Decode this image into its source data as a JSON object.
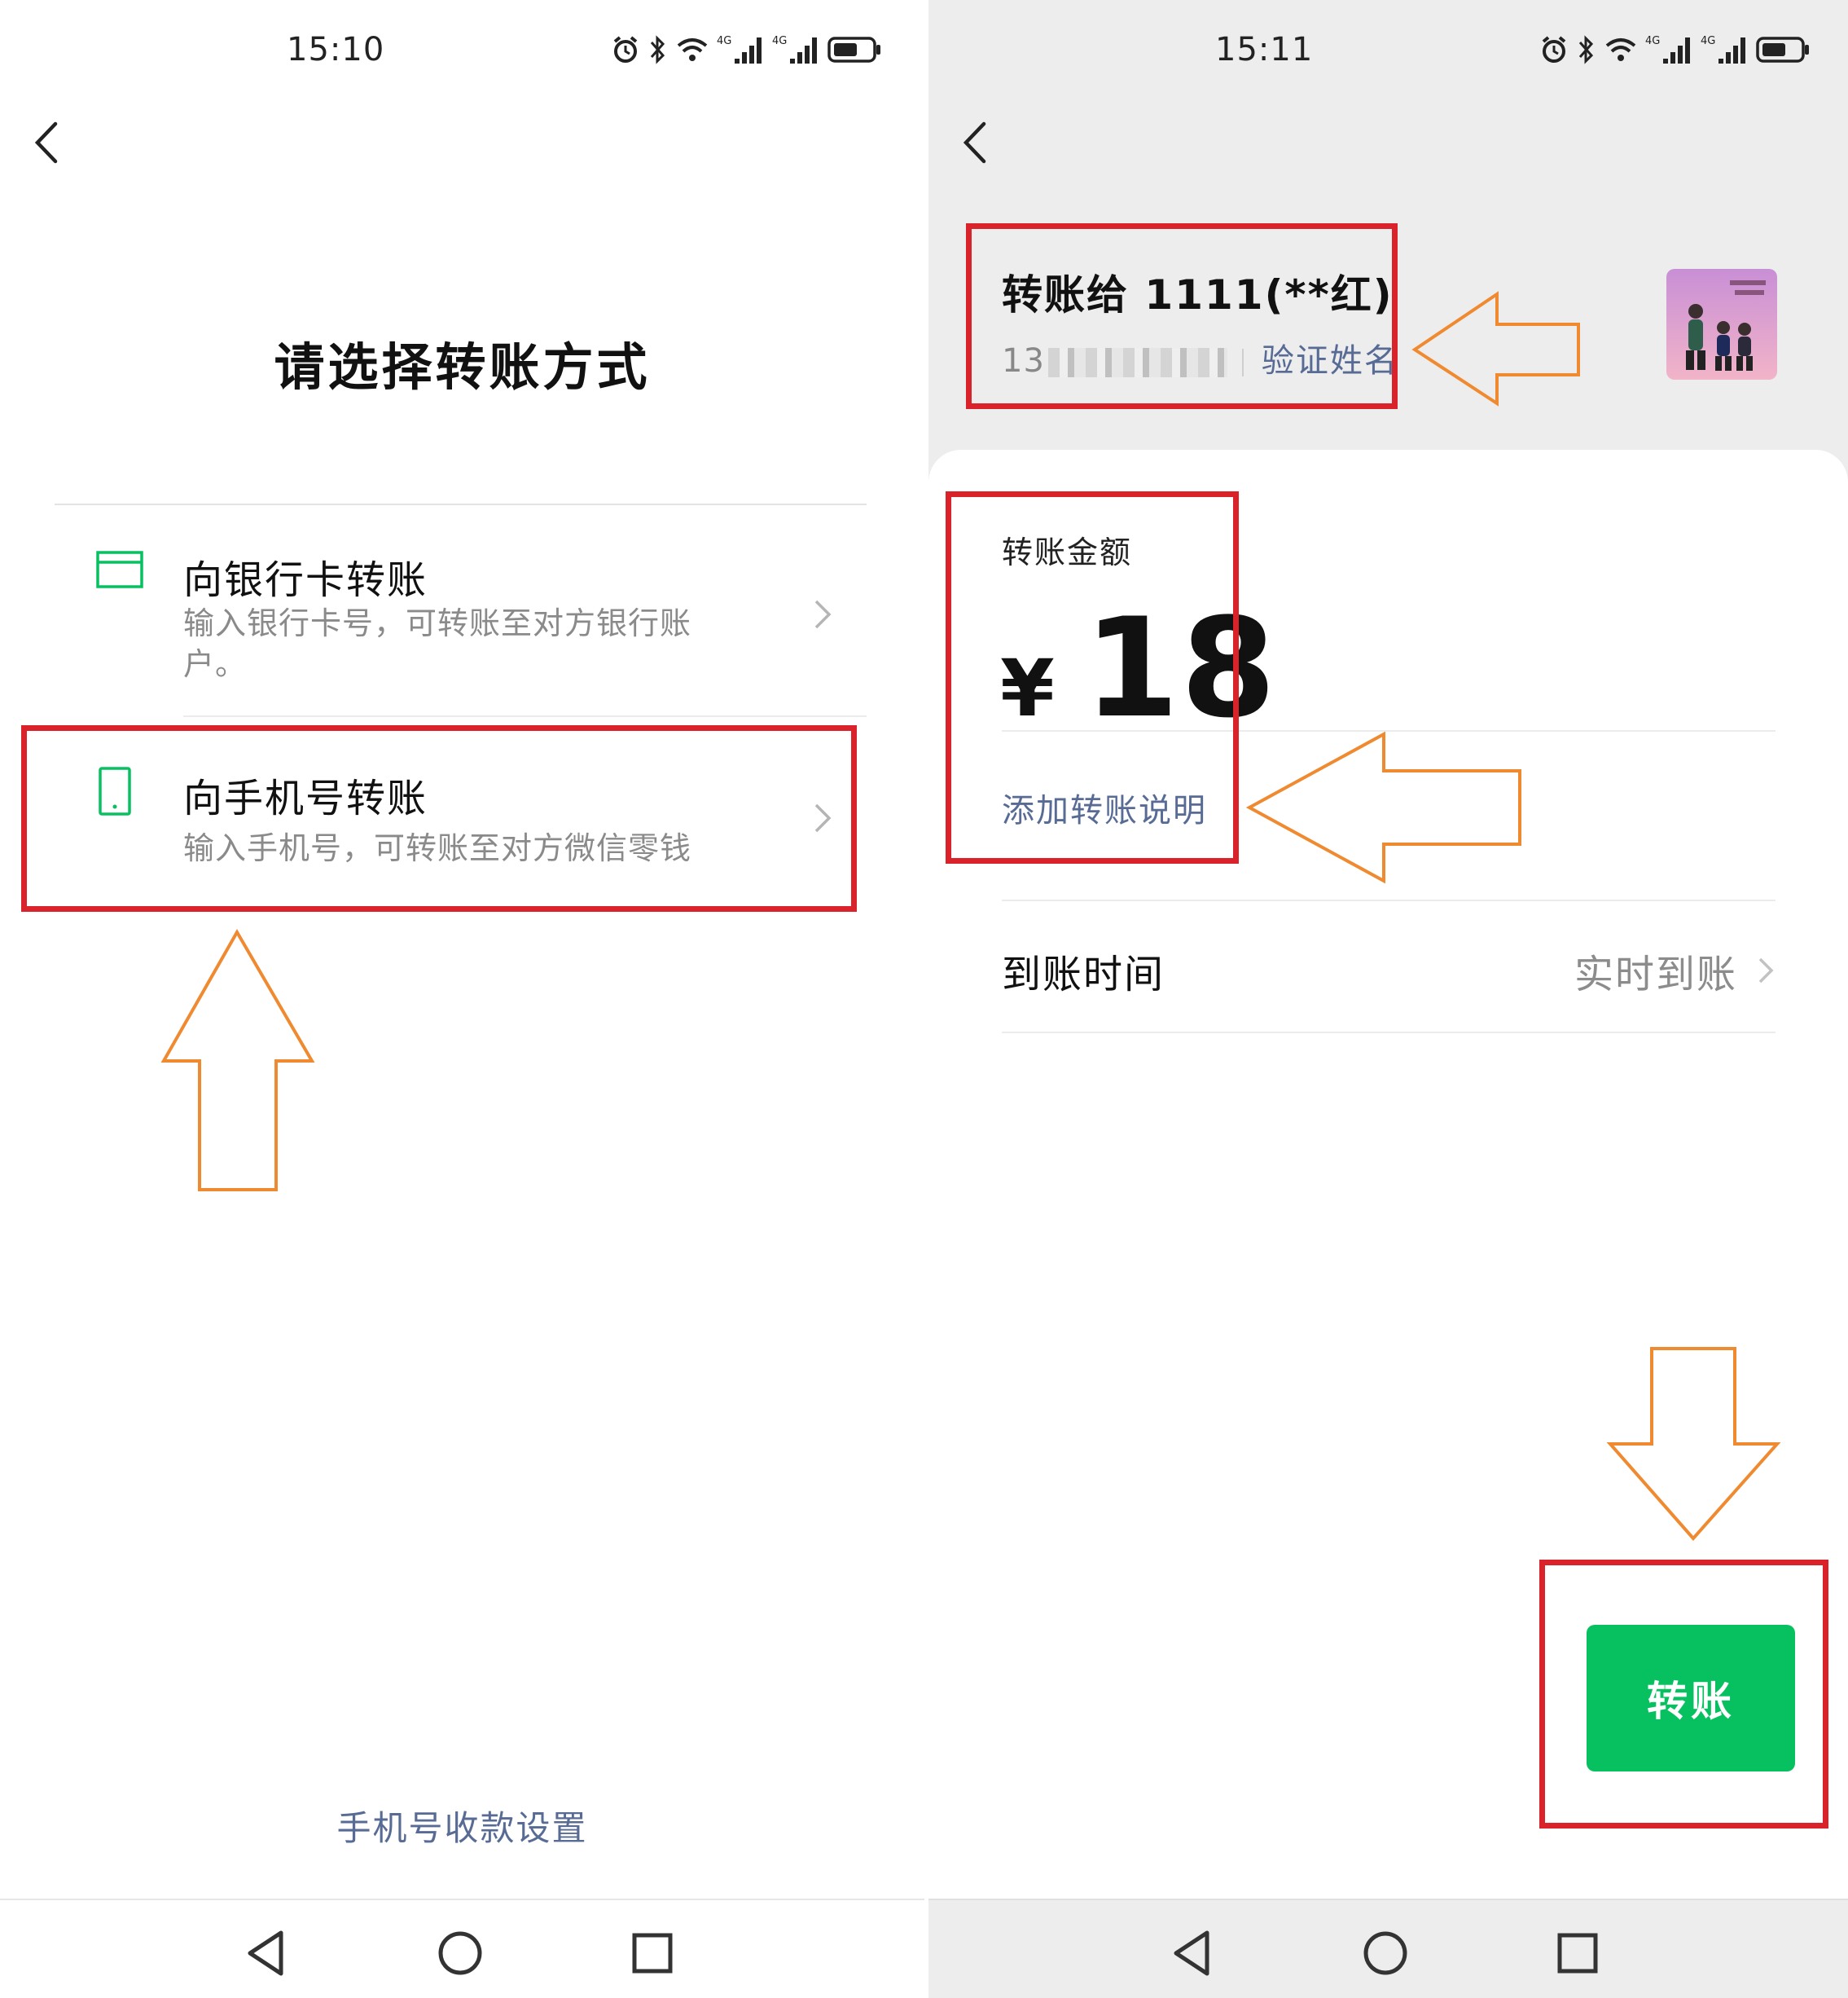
{
  "left_screen": {
    "status_time": "15:10",
    "page_title": "请选择转账方式",
    "options": [
      {
        "title": "向银行卡转账",
        "desc": "输入银行卡号，可转账至对方银行账户。",
        "icon": "bank-card-icon"
      },
      {
        "title": "向手机号转账",
        "desc": "输入手机号，可转账至对方微信零钱",
        "icon": "phone-icon"
      }
    ],
    "bottom_link": "手机号收款设置"
  },
  "right_screen": {
    "status_time": "15:11",
    "payee_name": "转账给 1111(**红)",
    "payee_phone_prefix": "13",
    "verify_name": "验证姓名",
    "amount_label": "转账金额",
    "currency": "¥",
    "amount": "18",
    "add_note": "添加转账说明",
    "arrival_label": "到账时间",
    "arrival_value": "实时到账",
    "transfer_button": "转账"
  },
  "status_icons": [
    "alarm-icon",
    "bluetooth-icon",
    "wifi-icon",
    "signal-4g-icon",
    "signal-4g-icon",
    "battery-icon"
  ],
  "status_4g_label": "4G",
  "colors": {
    "wechat_green": "#07c160",
    "link_blue": "#576b95",
    "highlight_red": "#d9222a",
    "arrow_orange": "#f08a30"
  }
}
